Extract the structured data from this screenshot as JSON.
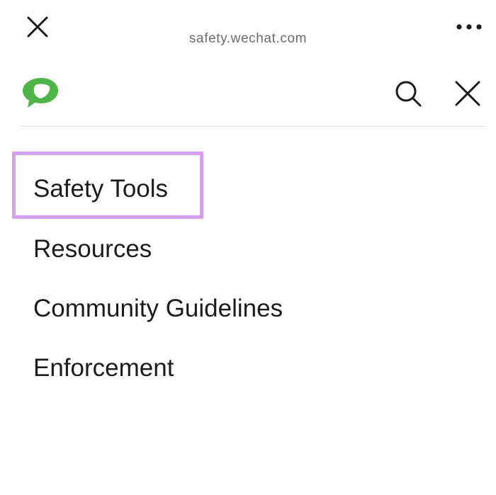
{
  "browser": {
    "url": "safety.wechat.com",
    "close_icon": "close-icon",
    "more_icon": "more-horizontal-icon"
  },
  "site_header": {
    "logo_icon": "wechat-safety-logo",
    "search_icon": "search-icon",
    "close_icon": "close-icon"
  },
  "nav": {
    "items": [
      {
        "label": "Safety Tools",
        "highlighted": true
      },
      {
        "label": "Resources",
        "highlighted": false
      },
      {
        "label": "Community Guidelines",
        "highlighted": false
      },
      {
        "label": "Enforcement",
        "highlighted": false
      }
    ]
  },
  "colors": {
    "brand_green": "#4fb548",
    "highlight": "#d89ff0",
    "text": "#1c1c1e",
    "url_text": "#6b6b6b",
    "divider": "#e3e3e3"
  }
}
